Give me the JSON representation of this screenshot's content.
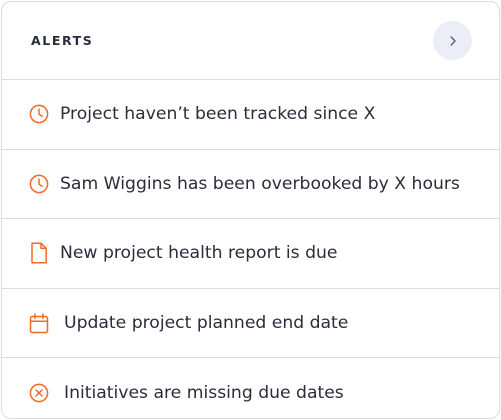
{
  "alerts_card": {
    "title": "ALERTS",
    "expand_icon": "chevron-right-icon",
    "accent_color": "#f06a28",
    "items": [
      {
        "icon": "clock-icon",
        "text": "Project haven’t been tracked since X"
      },
      {
        "icon": "clock-icon",
        "text": "Sam Wiggins has been overbooked by X hours"
      },
      {
        "icon": "document-icon",
        "text": "New project health report is due"
      },
      {
        "icon": "calendar-icon",
        "text": "Update project planned end date"
      },
      {
        "icon": "x-circle-icon",
        "text": "Initiatives are missing due dates"
      }
    ]
  }
}
